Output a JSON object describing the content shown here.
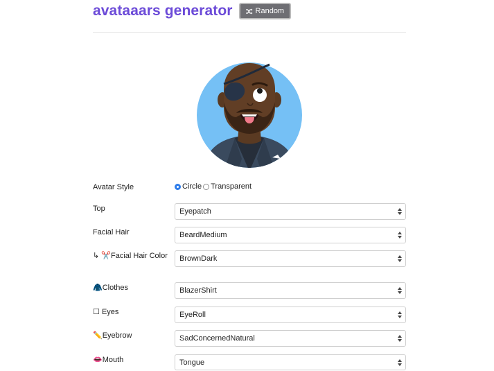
{
  "header": {
    "title": "avataaars generator",
    "random_label": "Random"
  },
  "colors": {
    "title": "#6c4bd8",
    "avatar_bg": "#75c0f5",
    "radio_active": "#2f7dea",
    "random_btn": "#6e6e73"
  },
  "avatar_style": {
    "label": "Avatar Style",
    "options": [
      {
        "label": "Circle",
        "checked": true
      },
      {
        "label": "Transparent",
        "checked": false
      }
    ]
  },
  "rows": [
    {
      "label": "Top",
      "value": "Eyepatch"
    },
    {
      "label": "Facial Hair",
      "value": "BeardMedium"
    },
    {
      "label_prefix": "↳ ✂️",
      "label": "Facial Hair Color",
      "value": "BrownDark"
    },
    {
      "label_prefix": "🧥",
      "label": "Clothes",
      "value": "BlazerShirt"
    },
    {
      "label_prefix": "☐",
      "label": "Eyes",
      "value": "EyeRoll"
    },
    {
      "label_prefix": "✏️",
      "label": "Eyebrow",
      "value": "SadConcernedNatural"
    },
    {
      "label_prefix": "👄",
      "label": "Mouth",
      "value": "Tongue"
    }
  ]
}
